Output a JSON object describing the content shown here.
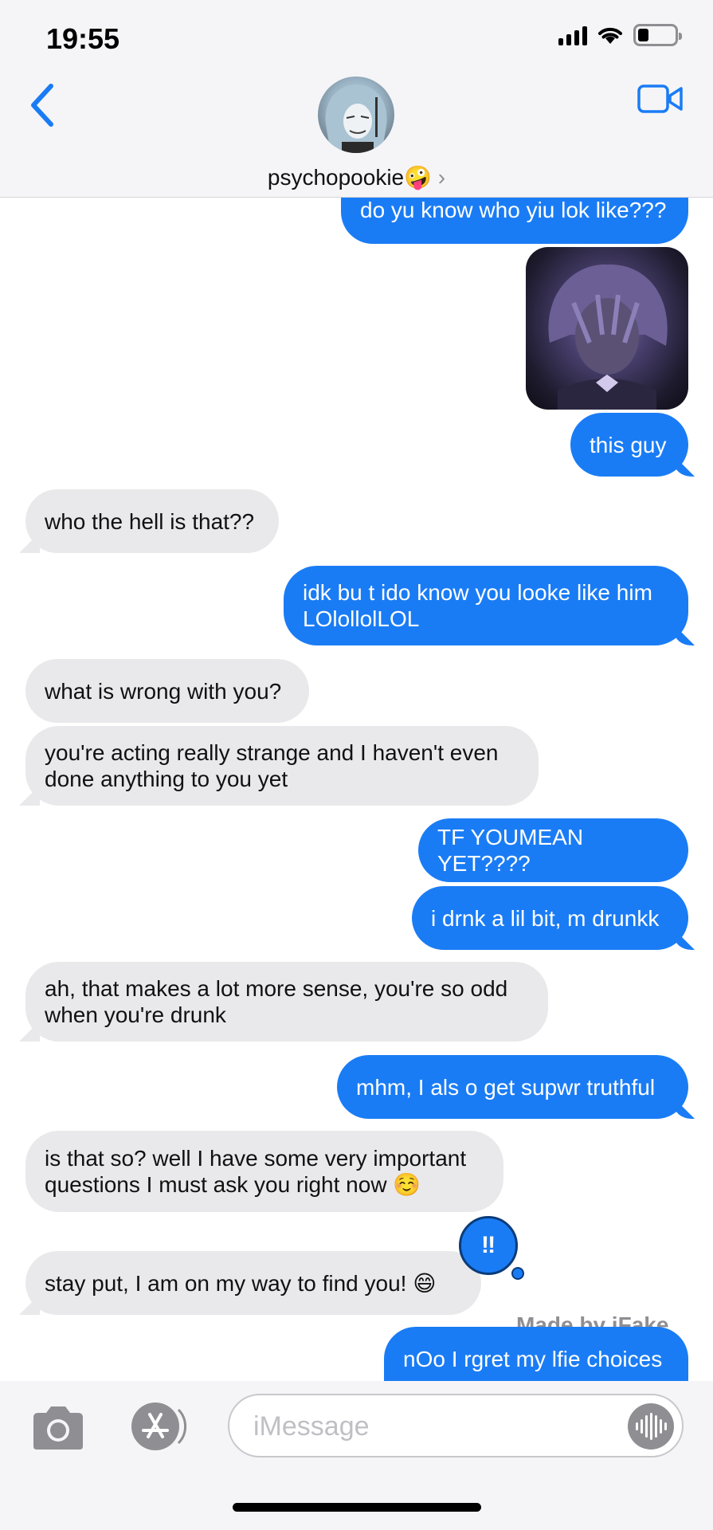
{
  "status": {
    "time": "19:55",
    "battery_level": 0.3
  },
  "header": {
    "contact_name": "psychopookie🤪",
    "chevron": "›",
    "back_icon": "chevron-left-icon",
    "video_icon": "video-camera-icon"
  },
  "messages": [
    {
      "dir": "out",
      "text": "do yu know who yiu lok like???"
    },
    {
      "dir": "out",
      "type": "image",
      "alt": "photo"
    },
    {
      "dir": "out",
      "text": "this guy"
    },
    {
      "dir": "in",
      "text": "who the hell is that??"
    },
    {
      "dir": "out",
      "text": "idk bu t ido know you looke like him LOlollolLOL"
    },
    {
      "dir": "in",
      "text": "what is wrong with you?"
    },
    {
      "dir": "in",
      "text": "you're acting really strange and I haven't even done anything to you yet"
    },
    {
      "dir": "out",
      "text": "TF YOUMEAN YET????"
    },
    {
      "dir": "out",
      "text": "i drnk a lil bit, m drunkk"
    },
    {
      "dir": "in",
      "text": "ah, that makes a lot more sense, you're so odd when you're drunk"
    },
    {
      "dir": "out",
      "text": "mhm, I als o get supwr truthful"
    },
    {
      "dir": "in",
      "text": "is that so? well I have some very important questions I must ask you right now ☺️"
    },
    {
      "dir": "in",
      "text": "stay put, I am on my way to find you! 😄"
    },
    {
      "dir": "out",
      "text": "nOo I rgret my lfie choices"
    }
  ],
  "reaction": {
    "symbol": "‼",
    "icon": "double-exclamation-icon"
  },
  "watermark": "Made by iFake",
  "input": {
    "placeholder": "iMessage",
    "camera_icon": "camera-icon",
    "appstore_icon": "app-store-icon",
    "voice_icon": "voice-waveform-icon"
  },
  "colors": {
    "outgoing": "#1a7cf5",
    "incoming": "#e9e9eb",
    "accent": "#1a7cf5"
  }
}
